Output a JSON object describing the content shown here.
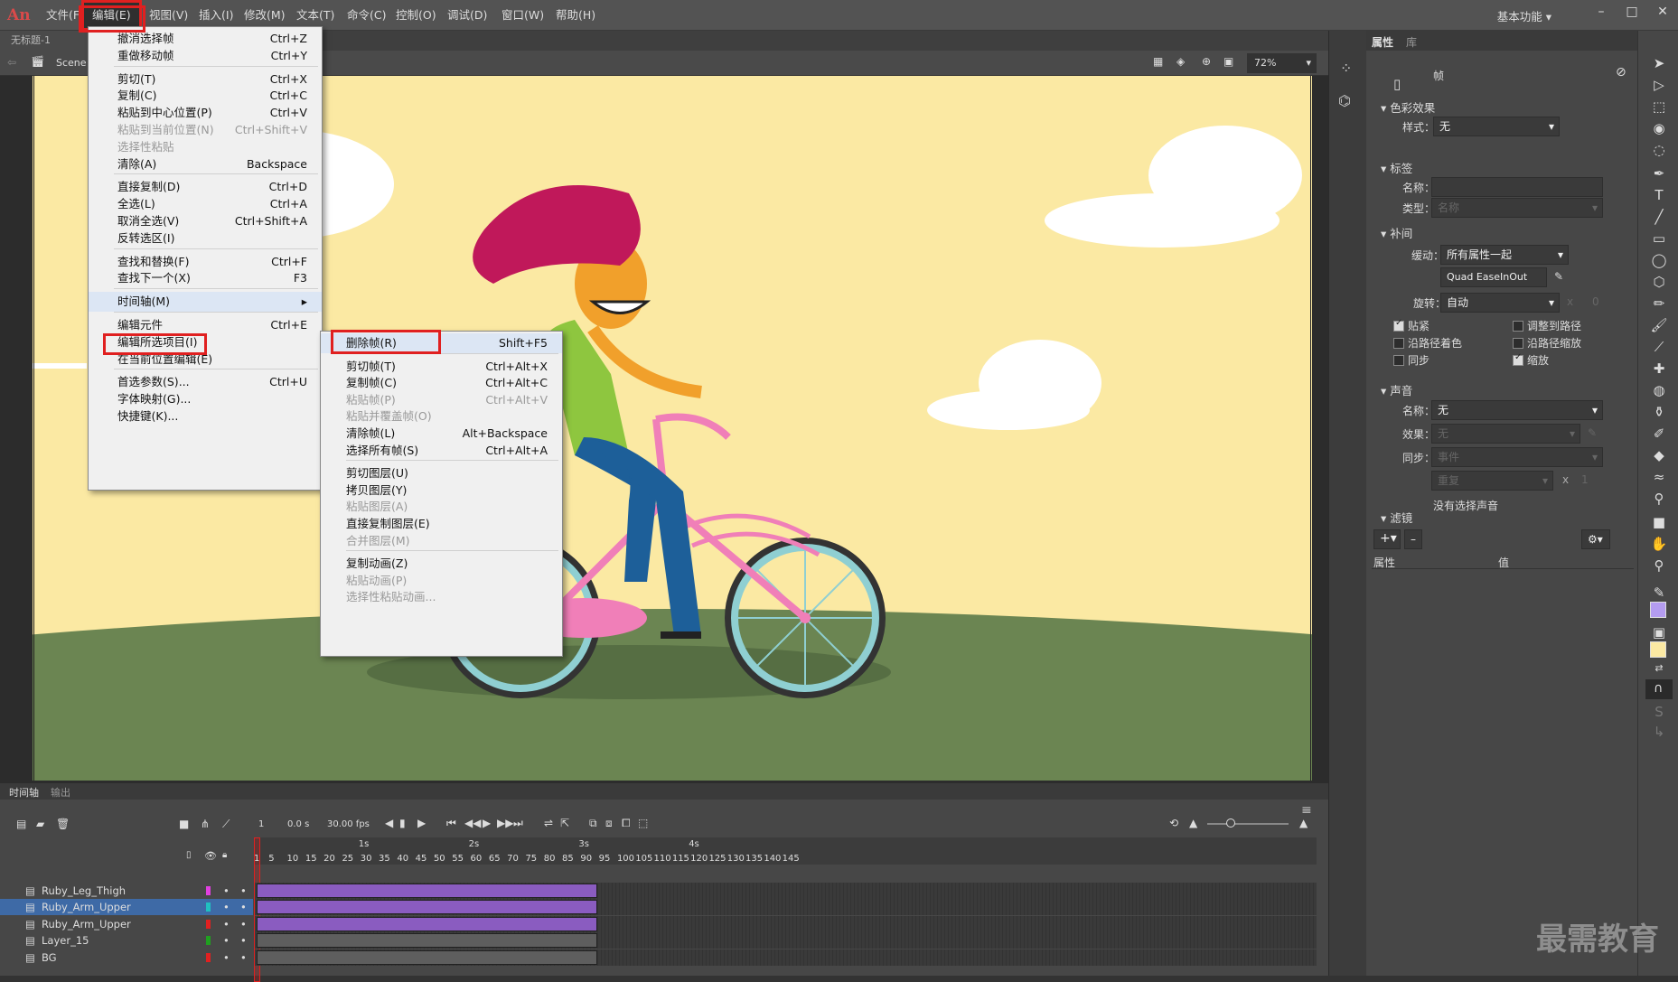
{
  "app": {
    "logo": "An",
    "workspace": "基本功能",
    "doc_tab": "无标题-1 (Canvas)",
    "scene": "Scene 1",
    "zoom": "72%"
  },
  "menubar": [
    "文件(F)",
    "编辑(E)",
    "视图(V)",
    "插入(I)",
    "修改(M)",
    "文本(T)",
    "命令(C)",
    "控制(O)",
    "调试(D)",
    "窗口(W)",
    "帮助(H)"
  ],
  "edit_menu": [
    {
      "label": "撤消选择帧",
      "sc": "Ctrl+Z"
    },
    {
      "label": "重做移动帧",
      "sc": "Ctrl+Y"
    },
    {
      "sep": true
    },
    {
      "label": "剪切(T)",
      "sc": "Ctrl+X"
    },
    {
      "label": "复制(C)",
      "sc": "Ctrl+C"
    },
    {
      "label": "粘贴到中心位置(P)",
      "sc": "Ctrl+V"
    },
    {
      "label": "粘贴到当前位置(N)",
      "sc": "Ctrl+Shift+V",
      "dis": true
    },
    {
      "label": "选择性粘贴",
      "dis": true
    },
    {
      "label": "清除(A)",
      "sc": "Backspace"
    },
    {
      "sep": true
    },
    {
      "label": "直接复制(D)",
      "sc": "Ctrl+D"
    },
    {
      "label": "全选(L)",
      "sc": "Ctrl+A"
    },
    {
      "label": "取消全选(V)",
      "sc": "Ctrl+Shift+A"
    },
    {
      "label": "反转选区(I)"
    },
    {
      "sep": true
    },
    {
      "label": "查找和替换(F)",
      "sc": "Ctrl+F"
    },
    {
      "label": "查找下一个(X)",
      "sc": "F3"
    },
    {
      "sep": true
    },
    {
      "label": "时间轴(M)",
      "arrow": "▸",
      "hl": true
    },
    {
      "sep": true
    },
    {
      "label": "编辑元件",
      "sc": "Ctrl+E"
    },
    {
      "label": "编辑所选项目(I)"
    },
    {
      "label": "在当前位置编辑(E)"
    },
    {
      "sep": true
    },
    {
      "label": "首选参数(S)...",
      "sc": "Ctrl+U"
    },
    {
      "label": "字体映射(G)..."
    },
    {
      "label": "快捷键(K)..."
    }
  ],
  "timeline_menu": [
    {
      "label": "删除帧(R)",
      "sc": "Shift+F5",
      "hl": true
    },
    {
      "sep": true
    },
    {
      "label": "剪切帧(T)",
      "sc": "Ctrl+Alt+X"
    },
    {
      "label": "复制帧(C)",
      "sc": "Ctrl+Alt+C"
    },
    {
      "label": "粘贴帧(P)",
      "sc": "Ctrl+Alt+V",
      "dis": true
    },
    {
      "label": "粘贴并覆盖帧(O)",
      "dis": true
    },
    {
      "label": "清除帧(L)",
      "sc": "Alt+Backspace"
    },
    {
      "label": "选择所有帧(S)",
      "sc": "Ctrl+Alt+A"
    },
    {
      "sep": true
    },
    {
      "label": "剪切图层(U)"
    },
    {
      "label": "拷贝图层(Y)"
    },
    {
      "label": "粘贴图层(A)",
      "dis": true
    },
    {
      "label": "直接复制图层(E)"
    },
    {
      "label": "合并图层(M)",
      "dis": true
    },
    {
      "sep": true
    },
    {
      "label": "复制动画(Z)"
    },
    {
      "label": "粘贴动画(P)",
      "dis": true
    },
    {
      "label": "选择性粘贴动画...",
      "dis": true
    }
  ],
  "props": {
    "tabs": [
      "属性",
      "库"
    ],
    "frame_label": "帧",
    "color_effect": "色彩效果",
    "style_label": "样式：",
    "style_val": "无",
    "label_sec": "标签",
    "name_label": "名称：",
    "type_label": "类型：",
    "type_val": "名称",
    "tween_sec": "补间",
    "ease_label": "缓动：",
    "ease_val": "所有属性一起",
    "ease_fn": "Quad EaseInOut",
    "rotate_label": "旋转：",
    "rotate_val": "自动",
    "rotate_x": "x",
    "rotate_n": "0",
    "chk": [
      {
        "l": "贴紧",
        "c": true
      },
      {
        "l": "调整到路径",
        "c": false
      },
      {
        "l": "沿路径着色",
        "c": false
      },
      {
        "l": "沿路径缩放",
        "c": false
      },
      {
        "l": "同步",
        "c": false
      },
      {
        "l": "缩放",
        "c": true
      }
    ],
    "sound_sec": "声音",
    "snd_name_label": "名称：",
    "snd_name": "无",
    "effect_label": "效果：",
    "effect_val": "无",
    "sync_label": "同步：",
    "sync_val": "事件",
    "repeat_val": "重复",
    "repeat_x": "x",
    "repeat_n": "1",
    "no_sound": "没有选择声音",
    "filter_sec": "滤镜",
    "col_prop": "属性",
    "col_val": "值"
  },
  "timeline": {
    "tabs": [
      "时间轴",
      "输出"
    ],
    "cur_frame": "1",
    "time": "0.0 s",
    "fps": "30.00 fps",
    "seconds": [
      "1s",
      "2s",
      "3s",
      "4s"
    ],
    "ticks": [
      "1",
      "5",
      "10",
      "15",
      "20",
      "25",
      "30",
      "35",
      "40",
      "45",
      "50",
      "55",
      "60",
      "65",
      "70",
      "75",
      "80",
      "85",
      "90",
      "95",
      "100",
      "105",
      "110",
      "115",
      "120",
      "125",
      "130",
      "135",
      "140",
      "145"
    ],
    "layers": [
      {
        "name": "Ruby_Leg_Thigh",
        "color": "#e040e0"
      },
      {
        "name": "Ruby_Arm_Upper",
        "color": "#20c0c0",
        "sel": true
      },
      {
        "name": "Ruby_Arm_Upper",
        "color": "#e02020"
      },
      {
        "name": "Layer_15",
        "color": "#20a020"
      },
      {
        "name": "BG",
        "color": "#e02020"
      }
    ]
  },
  "watermark": "最需教育"
}
